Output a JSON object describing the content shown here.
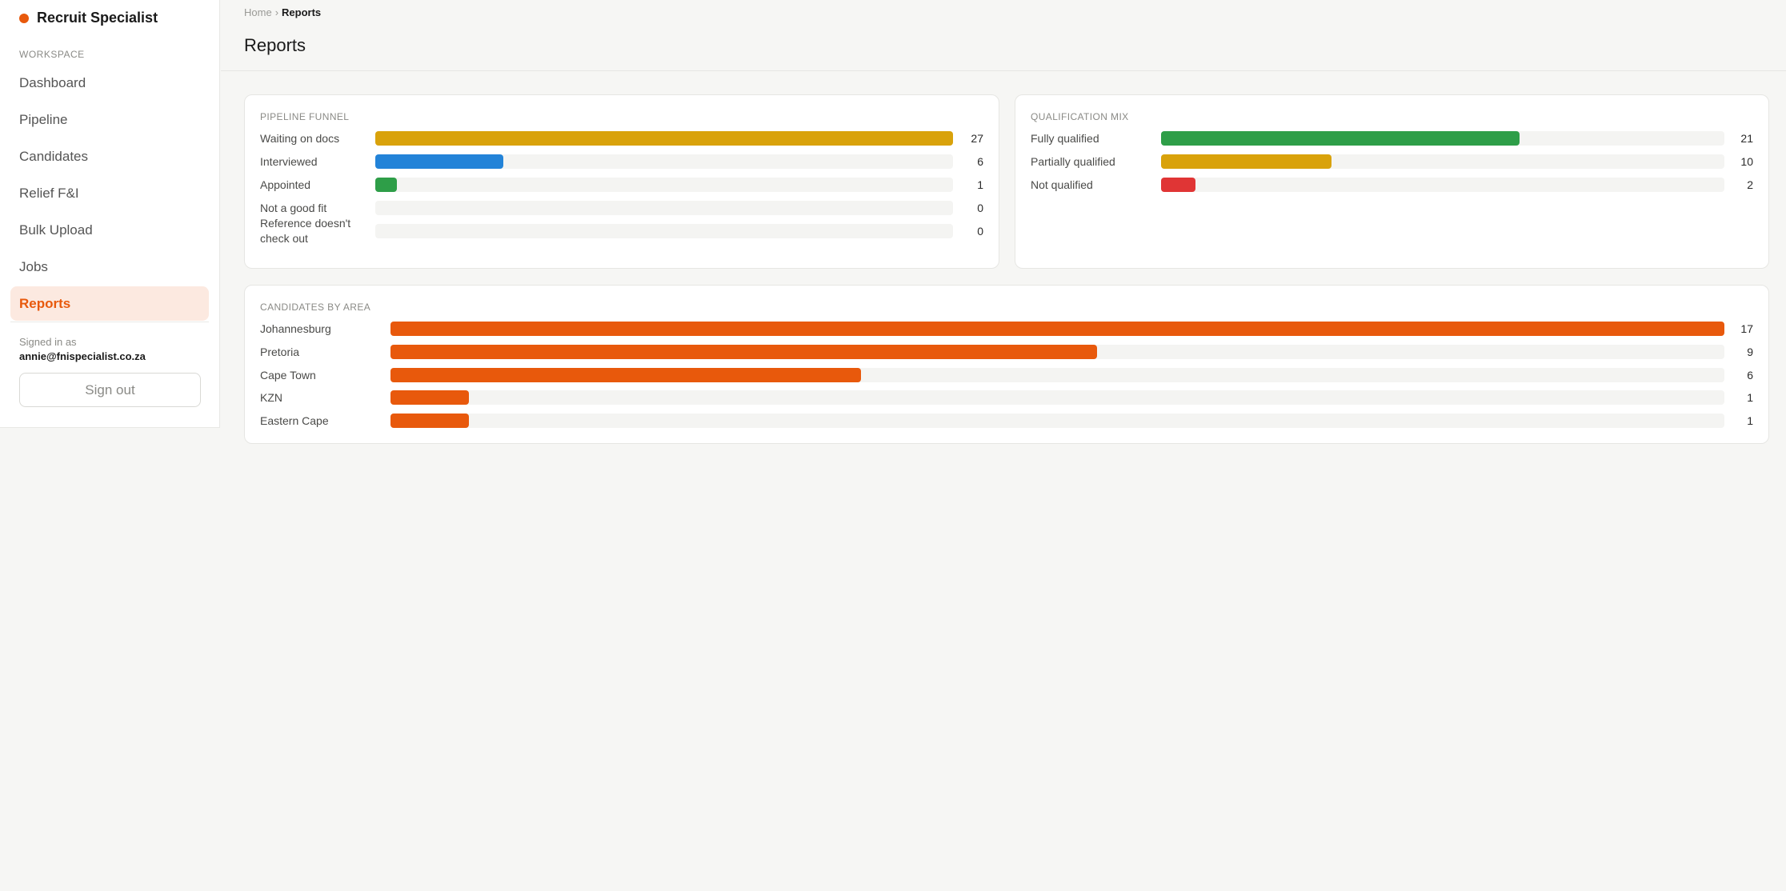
{
  "brand": {
    "name": "Recruit Specialist",
    "accent": "#e8590c"
  },
  "sidebar": {
    "section_label": "WORKSPACE",
    "items": [
      {
        "label": "Dashboard",
        "active": false
      },
      {
        "label": "Pipeline",
        "active": false
      },
      {
        "label": "Candidates",
        "active": false
      },
      {
        "label": "Relief F&I",
        "active": false
      },
      {
        "label": "Bulk Upload",
        "active": false
      },
      {
        "label": "Jobs",
        "active": false
      },
      {
        "label": "Reports",
        "active": true
      }
    ],
    "signed_in_label": "Signed in as",
    "signed_in_email": "annie@fnispecialist.co.za",
    "sign_out_label": "Sign out"
  },
  "breadcrumb": {
    "home": "Home",
    "separator": "›",
    "current": "Reports"
  },
  "page": {
    "title": "Reports"
  },
  "chart_data": [
    {
      "type": "bar",
      "orientation": "horizontal",
      "title": "PIPELINE FUNNEL",
      "categories": [
        "Waiting on docs",
        "Interviewed",
        "Appointed",
        "Not a good fit",
        "Reference doesn't check out"
      ],
      "values": [
        27,
        6,
        1,
        0,
        0
      ],
      "colors": [
        "#d9a20b",
        "#2383d8",
        "#2e9e48",
        "#d9a20b",
        "#d9a20b"
      ],
      "max": 27
    },
    {
      "type": "bar",
      "orientation": "horizontal",
      "title": "QUALIFICATION MIX",
      "categories": [
        "Fully qualified",
        "Partially qualified",
        "Not qualified"
      ],
      "values": [
        21,
        10,
        2
      ],
      "colors": [
        "#2e9e48",
        "#d9a20b",
        "#e03535"
      ],
      "max": 33
    },
    {
      "type": "bar",
      "orientation": "horizontal",
      "title": "CANDIDATES BY AREA",
      "categories": [
        "Johannesburg",
        "Pretoria",
        "Cape Town",
        "KZN",
        "Eastern Cape"
      ],
      "values": [
        17,
        9,
        6,
        1,
        1
      ],
      "colors": [
        "#e8590c",
        "#e8590c",
        "#e8590c",
        "#e8590c",
        "#e8590c"
      ],
      "max": 17
    }
  ]
}
